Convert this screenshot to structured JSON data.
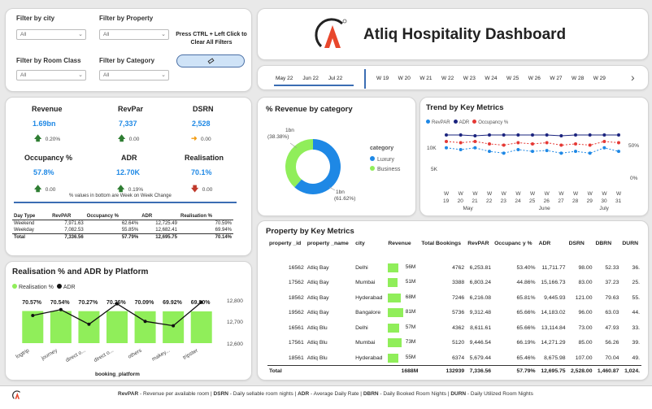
{
  "filters": {
    "city": {
      "label": "Filter by city",
      "value": "All"
    },
    "property": {
      "label": "Filter by Property",
      "value": "All"
    },
    "room_class": {
      "label": "Filter by Room Class",
      "value": "All"
    },
    "category": {
      "label": "Filter by Category",
      "value": "All"
    },
    "clear_hint": "Press CTRL + Left Click to Clear All Filters",
    "clear_icon": "eraser-icon"
  },
  "header": {
    "title": "Atliq Hospitality Dashboard",
    "logo_icon": "atliq-logo-icon"
  },
  "timeline": {
    "months": [
      "May 22",
      "Jun 22",
      "Jul 22"
    ],
    "weeks": [
      "W 19",
      "W 20",
      "W 21",
      "W 22",
      "W 23",
      "W 24",
      "W 25",
      "W 26",
      "W 27",
      "W 28",
      "W 29"
    ]
  },
  "kpis": {
    "revenue": {
      "title": "Revenue",
      "value": "1.69bn",
      "change": "0.20%",
      "dir": "up"
    },
    "revpar": {
      "title": "RevPar",
      "value": "7,337",
      "change": "0.00",
      "dir": "up"
    },
    "dsrn": {
      "title": "DSRN",
      "value": "2,528",
      "change": "0.00",
      "dir": "right"
    },
    "occupancy": {
      "title": "Occupancy %",
      "value": "57.8%",
      "change": "0.00",
      "dir": "up"
    },
    "adr": {
      "title": "ADR",
      "value": "12.70K",
      "change": "0.19%",
      "dir": "up"
    },
    "realisation": {
      "title": "Realisation",
      "value": "70.1%",
      "change": "0.00",
      "dir": "down"
    },
    "note": "% values in bottom are Week on Week Change"
  },
  "day_type_table": {
    "headers": [
      "Day Type",
      "RevPAR",
      "Occupancy %",
      "ADR",
      "Realisation %"
    ],
    "rows": [
      [
        "Weekend",
        "7,971.63",
        "62.64%",
        "12,725.49",
        "70.59%"
      ],
      [
        "Weekday",
        "7,082.53",
        "55.85%",
        "12,682.41",
        "69.94%"
      ]
    ],
    "total": [
      "Total",
      "7,336.56",
      "57.79%",
      "12,695.75",
      "70.14%"
    ]
  },
  "revenue_by_category": {
    "title": "% Revenue by category",
    "legend_title": "category",
    "chart_data": {
      "type": "pie",
      "categories": [
        "Luxury",
        "Business"
      ],
      "values": [
        61.62,
        38.38
      ],
      "labels": [
        "1bn (61.62%)",
        "1bn (38.38%)"
      ],
      "colors": [
        "#1e88e5",
        "#90ee5a"
      ]
    }
  },
  "trend": {
    "title": "Trend by Key Metrics",
    "legend": [
      "RevPAR",
      "ADR",
      "Occupancy %"
    ],
    "colors": [
      "#1e88e5",
      "#1a237e",
      "#e53935"
    ],
    "chart_data": {
      "type": "line",
      "x": [
        "W 19",
        "W 20",
        "W 21",
        "W 22",
        "W 23",
        "W 24",
        "W 25",
        "W 26",
        "W 27",
        "W 28",
        "W 29",
        "W 30",
        "W 31"
      ],
      "x_numbers": [
        "19",
        "20",
        "21",
        "22",
        "23",
        "24",
        "25",
        "26",
        "27",
        "28",
        "29",
        "30",
        "31"
      ],
      "x_months": [
        "May",
        "June",
        "July"
      ],
      "y_left_ticks": [
        "10K",
        "5K"
      ],
      "y_right_ticks": [
        "50%",
        "0%"
      ],
      "ylim_left": [
        4000,
        14000
      ],
      "ylim_right": [
        0,
        100
      ],
      "series": [
        {
          "name": "RevPAR",
          "axis": "left",
          "values": [
            7500,
            7400,
            7500,
            7300,
            7200,
            7400,
            7300,
            7350,
            7200,
            7300,
            7200,
            7500,
            7300
          ]
        },
        {
          "name": "ADR",
          "axis": "left",
          "values": [
            12700,
            12700,
            12650,
            12700,
            12700,
            12700,
            12700,
            12700,
            12650,
            12700,
            12700,
            12700,
            12700
          ]
        },
        {
          "name": "Occupancy %",
          "axis": "right",
          "values": [
            59,
            58,
            59,
            57,
            56,
            58,
            57,
            58,
            56,
            57,
            56,
            59,
            58
          ]
        }
      ]
    }
  },
  "property_table": {
    "title": "Property by Key Metrics",
    "headers": [
      "property _id",
      "property _name",
      "city",
      "Revenue",
      "Total Bookings",
      "RevPAR",
      "Occupanc y %",
      "ADR",
      "DSRN",
      "DBRN",
      "DURN"
    ],
    "revenue_max": 81,
    "rows": [
      {
        "id": "16562",
        "name": "Atliq Bay",
        "city": "Delhi",
        "revenue": "56M",
        "rev_num": 56,
        "bookings": "4762",
        "revpar": "6,253.81",
        "occ": "53.40%",
        "adr": "11,711.77",
        "dsrn": "98.00",
        "dbrn": "52.33",
        "durn": "36."
      },
      {
        "id": "17562",
        "name": "Atliq Bay",
        "city": "Mumbai",
        "revenue": "51M",
        "rev_num": 51,
        "bookings": "3388",
        "revpar": "6,803.24",
        "occ": "44.86%",
        "adr": "15,166.73",
        "dsrn": "83.00",
        "dbrn": "37.23",
        "durn": "25."
      },
      {
        "id": "18562",
        "name": "Atliq Bay",
        "city": "Hyderabad",
        "revenue": "68M",
        "rev_num": 68,
        "bookings": "7246",
        "revpar": "6,216.08",
        "occ": "65.81%",
        "adr": "9,445.93",
        "dsrn": "121.00",
        "dbrn": "79.63",
        "durn": "55."
      },
      {
        "id": "19562",
        "name": "Atliq Bay",
        "city": "Bangalore",
        "revenue": "81M",
        "rev_num": 81,
        "bookings": "5736",
        "revpar": "9,312.48",
        "occ": "65.66%",
        "adr": "14,183.02",
        "dsrn": "96.00",
        "dbrn": "63.03",
        "durn": "44."
      },
      {
        "id": "16561",
        "name": "Atliq Blu",
        "city": "Delhi",
        "revenue": "57M",
        "rev_num": 57,
        "bookings": "4362",
        "revpar": "8,611.61",
        "occ": "65.66%",
        "adr": "13,114.84",
        "dsrn": "73.00",
        "dbrn": "47.93",
        "durn": "33."
      },
      {
        "id": "17561",
        "name": "Atliq Blu",
        "city": "Mumbai",
        "revenue": "73M",
        "rev_num": 73,
        "bookings": "5120",
        "revpar": "9,446.54",
        "occ": "66.19%",
        "adr": "14,271.29",
        "dsrn": "85.00",
        "dbrn": "56.26",
        "durn": "39."
      },
      {
        "id": "18561",
        "name": "Atliq Blu",
        "city": "Hyderabad",
        "revenue": "55M",
        "rev_num": 55,
        "bookings": "6374",
        "revpar": "5,679.44",
        "occ": "65.46%",
        "adr": "8,675.98",
        "dsrn": "107.00",
        "dbrn": "70.04",
        "durn": "49."
      }
    ],
    "total": {
      "label": "Total",
      "revenue": "1688M",
      "bookings": "132939",
      "revpar": "7,336.56",
      "occ": "57.79%",
      "adr": "12,695.75",
      "dsrn": "2,528.00",
      "dbrn": "1,460.87",
      "durn": "1,024."
    }
  },
  "platform": {
    "title": "Realisation % and ADR by Platform",
    "legend": [
      "Realisation %",
      "ADR"
    ],
    "xlabel": "booking_platform",
    "chart_data": {
      "type": "bar",
      "categories": [
        "logtrip",
        "journey",
        "direct o...",
        "direct o...",
        "others",
        "makey...",
        "tripster"
      ],
      "series": [
        {
          "name": "Realisation %",
          "values": [
            70.57,
            70.54,
            70.27,
            70.26,
            70.09,
            69.92,
            69.8
          ]
        },
        {
          "name": "ADR",
          "values": [
            12700,
            12740,
            12640,
            12780,
            12660,
            12630,
            12790
          ]
        }
      ],
      "bar_labels": [
        "70.57%",
        "70.54%",
        "70.27%",
        "70.26%",
        "70.09%",
        "69.92%",
        "69.80%"
      ],
      "y_right_ticks": [
        "12,800",
        "12,700",
        "12,600"
      ],
      "ylim_right": [
        12600,
        12800
      ],
      "ylim_left": [
        0,
        75
      ]
    }
  },
  "footer": {
    "text_parts": [
      {
        "b": "RevPAR",
        "t": " - Revenue per available room | "
      },
      {
        "b": "DSRN",
        "t": " - Daily sellable room nights | "
      },
      {
        "b": "ADR",
        "t": " - Average Daily Rate | "
      },
      {
        "b": "DBRN",
        "t": " - Daily Booked Room Nights | "
      },
      {
        "b": "DURN",
        "t": " - Daily Utilized Room Nights"
      }
    ]
  }
}
